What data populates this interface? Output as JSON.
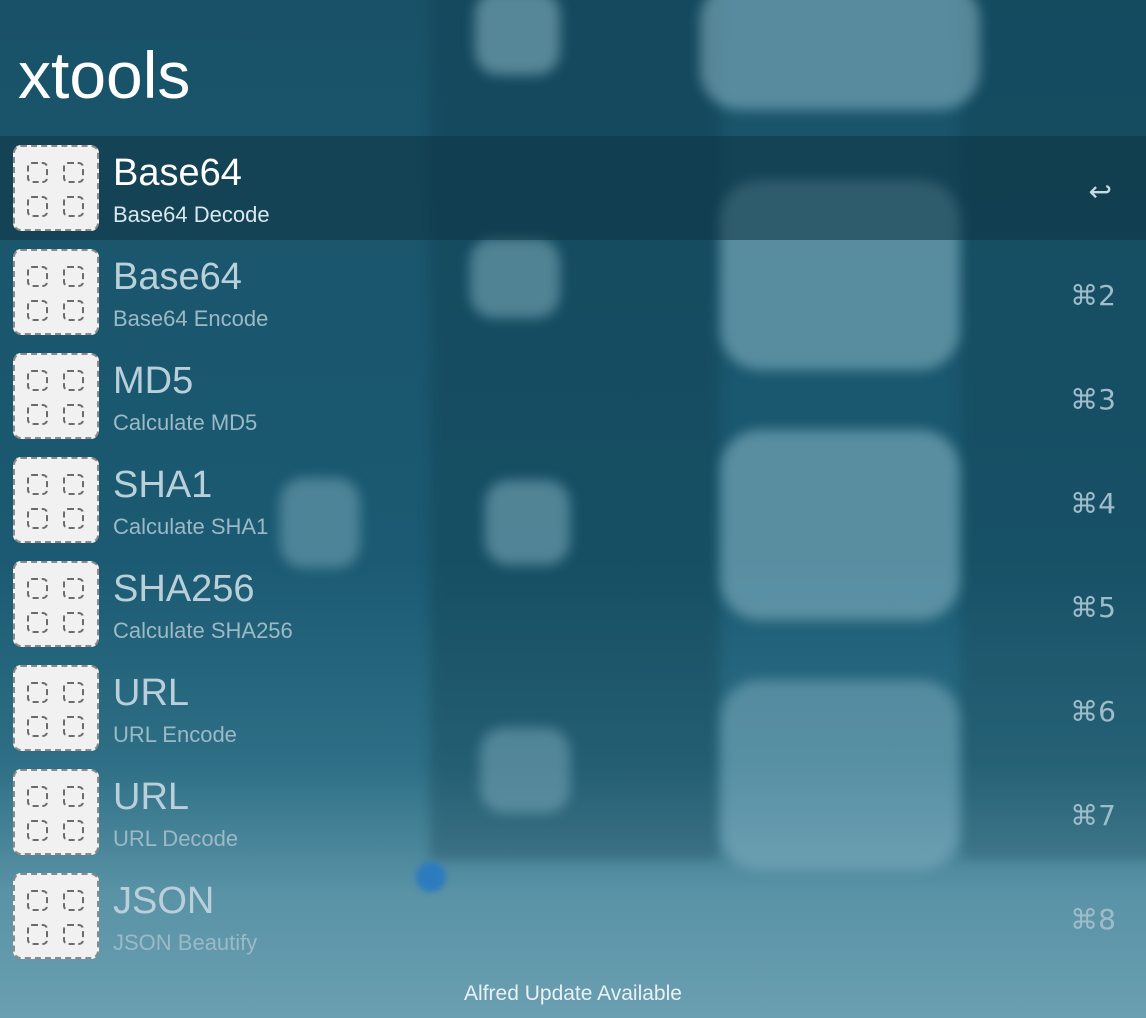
{
  "search": {
    "query": "xtools"
  },
  "results": [
    {
      "title": "Base64",
      "subtitle": "Base64 Decode",
      "shortcut": "↩",
      "selected": true
    },
    {
      "title": "Base64",
      "subtitle": "Base64 Encode",
      "shortcut": "⌘2",
      "selected": false
    },
    {
      "title": "MD5",
      "subtitle": "Calculate MD5",
      "shortcut": "⌘3",
      "selected": false
    },
    {
      "title": "SHA1",
      "subtitle": "Calculate SHA1",
      "shortcut": "⌘4",
      "selected": false
    },
    {
      "title": "SHA256",
      "subtitle": "Calculate SHA256",
      "shortcut": "⌘5",
      "selected": false
    },
    {
      "title": "URL",
      "subtitle": "URL Encode",
      "shortcut": "⌘6",
      "selected": false
    },
    {
      "title": "URL",
      "subtitle": "URL Decode",
      "shortcut": "⌘7",
      "selected": false
    },
    {
      "title": "JSON",
      "subtitle": "JSON Beautify",
      "shortcut": "⌘8",
      "selected": false
    }
  ],
  "icons": {
    "result_icon": "workflow-placeholder-icon"
  },
  "footer": {
    "text": "Alfred Update Available"
  },
  "colors": {
    "background": "#195268",
    "selected_row": "#0e3444",
    "text_primary": "#ffffff",
    "text_muted": "#b9d0da"
  }
}
